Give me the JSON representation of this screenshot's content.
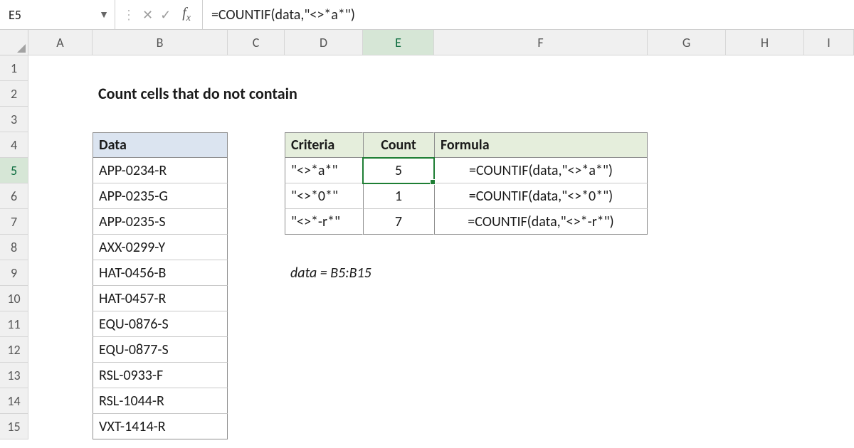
{
  "name_box": "E5",
  "formula_bar": "=COUNTIF(data,\"<>*a*\")",
  "columns": [
    "A",
    "B",
    "C",
    "D",
    "E",
    "F",
    "G",
    "H",
    "I"
  ],
  "rows": [
    "1",
    "2",
    "3",
    "4",
    "5",
    "6",
    "7",
    "8",
    "9",
    "10",
    "11",
    "12",
    "13",
    "14",
    "15"
  ],
  "title": "Count cells that do not contain",
  "data_header": "Data",
  "data_values": [
    "APP-0234-R",
    "APP-0235-G",
    "APP-0235-S",
    "AXX-0299-Y",
    "HAT-0456-B",
    "HAT-0457-R",
    "EQU-0876-S",
    "EQU-0877-S",
    "RSL-0933-F",
    "RSL-1044-R",
    "VXT-1414-R"
  ],
  "results_headers": {
    "criteria": "Criteria",
    "count": "Count",
    "formula": "Formula"
  },
  "results_rows": [
    {
      "criteria": "\"<>*a*\"",
      "count": "5",
      "formula": "=COUNTIF(data,\"<>*a*\")"
    },
    {
      "criteria": "\"<>*0*\"",
      "count": "1",
      "formula": "=COUNTIF(data,\"<>*0*\")"
    },
    {
      "criteria": "\"<>*-r*\"",
      "count": "7",
      "formula": "=COUNTIF(data,\"<>*-r*\")"
    }
  ],
  "range_note": "data = B5:B15"
}
